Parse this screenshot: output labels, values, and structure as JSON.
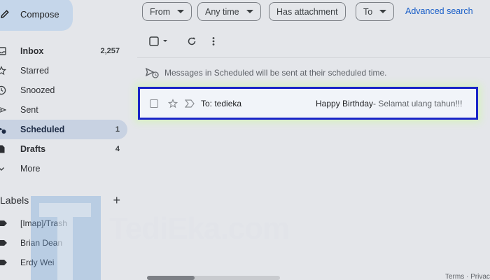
{
  "sidebar": {
    "compose_label": "Compose",
    "items": [
      {
        "label": "Inbox",
        "count": "2,257",
        "icon": "inbox-icon"
      },
      {
        "label": "Starred",
        "count": "",
        "icon": "star-icon"
      },
      {
        "label": "Snoozed",
        "count": "",
        "icon": "clock-icon"
      },
      {
        "label": "Sent",
        "count": "",
        "icon": "send-icon"
      },
      {
        "label": "Scheduled",
        "count": "1",
        "icon": "scheduled-send-icon"
      },
      {
        "label": "Drafts",
        "count": "4",
        "icon": "draft-icon"
      },
      {
        "label": "More",
        "count": "",
        "icon": "chevron-down-icon"
      }
    ],
    "labels_title": "Labels",
    "labels": [
      {
        "label": "[Imap]/Trash"
      },
      {
        "label": "Brian Dean"
      },
      {
        "label": "Erdy Wei"
      }
    ]
  },
  "search_chips": {
    "from": "From",
    "any_time": "Any time",
    "has_attachment": "Has attachment",
    "to": "To",
    "advanced_search": "Advanced search"
  },
  "scheduled_info": "Messages in Scheduled will be sent at their scheduled time.",
  "email_row": {
    "recipient": "To: tedieka",
    "subject": "Happy Birthday",
    "snippet": " - Selamat ulang tahun!!!"
  },
  "watermark": {
    "letter": "T",
    "text": "TediEka.com"
  },
  "footer": {
    "text": "Terms · Privacy"
  },
  "colors": {
    "highlight_border": "#1a25c8",
    "active_nav": "#c8d2e2",
    "link": "#1a5fc8"
  }
}
